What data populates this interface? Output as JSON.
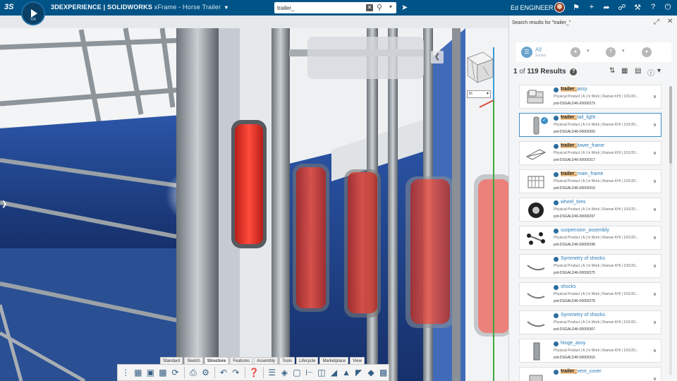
{
  "header": {
    "logo": "3S",
    "brand": "3DEXPERIENCE | SOLIDWORKS",
    "app_title": "xFrame - Horse Trailer",
    "compass_version": "V,R",
    "search_value": "trailer_",
    "user_name": "Ed ENGINEER"
  },
  "viewport": {
    "unit_select": "in"
  },
  "toolbar": {
    "tabs": [
      "Standard",
      "Sketch",
      "Structure",
      "Features",
      "Assembly",
      "Tools",
      "Lifecycle",
      "Marketplace",
      "View"
    ],
    "active_tab": "Structure"
  },
  "panel": {
    "title": "Search results for \"trailer_\"",
    "filter_all_label": "All",
    "filter_all_sub": "Sorted",
    "results_current": "1",
    "results_of": "of",
    "results_total": "119",
    "results_label": "Results",
    "results": [
      {
        "highlight": "trailer_",
        "rest": "assy",
        "meta": "Physical Product | A | In Work | Raman KHI | 10/1/20...",
        "id": "prd-DSGALD46-00000279",
        "thumb": "assembly",
        "selected": false
      },
      {
        "highlight": "trailer_",
        "rest": "tail_light",
        "meta": "Physical Product | A | In Work | Raman KHI | 10/1/20...",
        "id": "prd-DSGALD46-00000300",
        "thumb": "tail-light",
        "selected": true
      },
      {
        "highlight": "trailer_",
        "rest": "lower_frame",
        "meta": "Physical Product | A | In Work | Raman KHI | 10/1/20...",
        "id": "prd-DSGALD46-00000317",
        "thumb": "frame",
        "selected": false
      },
      {
        "highlight": "trailer_",
        "rest": "main_frame",
        "meta": "Physical Product | A | In Work | Raman KHI | 10/1/20...",
        "id": "prd-DSGALD46-00000319",
        "thumb": "cage",
        "selected": false
      },
      {
        "highlight": "",
        "rest": "wheel_tires",
        "meta": "Physical Product | A | In Work | Raman KHI | 10/1/20...",
        "id": "prd-DSGALD46-00000297",
        "thumb": "tire",
        "selected": false
      },
      {
        "highlight": "",
        "rest": "suspension_assembly",
        "meta": "Physical Product | A | In Work | Raman KHI | 10/1/20...",
        "id": "prd-DSGALD46-00000298",
        "thumb": "axle",
        "selected": false
      },
      {
        "highlight": "",
        "rest": "Symmetry of shocks",
        "meta": "Physical Product | A | In Work | Raman KHI | 10/1/20...",
        "id": "prd-DSGALD46-00000275",
        "thumb": "shock",
        "selected": false
      },
      {
        "highlight": "",
        "rest": "shocks",
        "meta": "Physical Product | A | In Work | Raman KHI | 10/1/20...",
        "id": "prd-DSGALD46-00000278",
        "thumb": "shock",
        "selected": false
      },
      {
        "highlight": "",
        "rest": "Symmetry of shocks",
        "meta": "Physical Product | A | In Work | Raman KHI | 10/1/20...",
        "id": "prd-DSGALD46-00000307",
        "thumb": "shock",
        "selected": false
      },
      {
        "highlight": "",
        "rest": "hinge_assy",
        "meta": "Physical Product | A | In Work | Raman KHI | 10/1/20...",
        "id": "prd-DSGALD46-00000316",
        "thumb": "hinge",
        "selected": false
      },
      {
        "highlight": "trailer_",
        "rest": "vent_cover",
        "meta": "",
        "id": "",
        "thumb": "vent",
        "selected": false
      }
    ]
  },
  "colors": {
    "topbar": "#005386",
    "accent": "#3d8fc6",
    "highlight": "#f2c48a",
    "tail_light_red": "#e3342f"
  }
}
